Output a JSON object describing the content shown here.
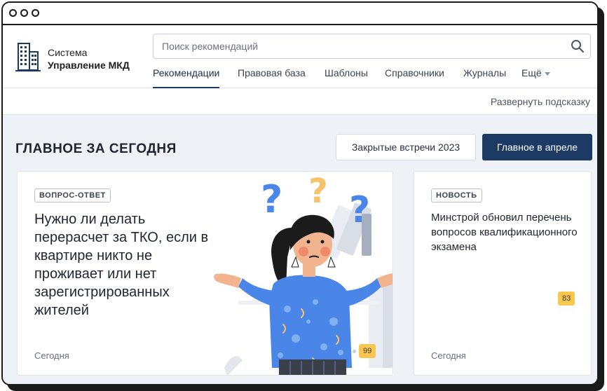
{
  "brand": {
    "line1": "Система",
    "line2": "Управление МКД"
  },
  "search": {
    "placeholder": "Поиск рекомендаций"
  },
  "nav": {
    "items": [
      {
        "label": "Рекомендации",
        "active": true
      },
      {
        "label": "Правовая база"
      },
      {
        "label": "Шаблоны"
      },
      {
        "label": "Справочники"
      },
      {
        "label": "Журналы"
      },
      {
        "label": "Ещё"
      }
    ]
  },
  "hint": {
    "label": "Развернуть подсказку"
  },
  "section": {
    "title": "ГЛАВНОЕ ЗА СЕГОДНЯ"
  },
  "buttons": {
    "closed_meetings": "Закрытые встречи 2023",
    "april_main": "Главное в апреле"
  },
  "cards": [
    {
      "tag": "ВОПРОС-ОТВЕТ",
      "title": "Нужно ли делать перерасчет за ТКО, если в квартире никто не проживает или нет зарегистрированных жителей",
      "date": "Сегодня",
      "count": "99"
    },
    {
      "tag": "НОВОСТЬ",
      "title": "Минстрой обновил перечень вопросов квалификационного экзамена",
      "date": "Сегодня",
      "count": "83"
    }
  ],
  "colors": {
    "primary": "#1c3a63",
    "badge": "#f9c74f",
    "background": "#eef1f5"
  }
}
